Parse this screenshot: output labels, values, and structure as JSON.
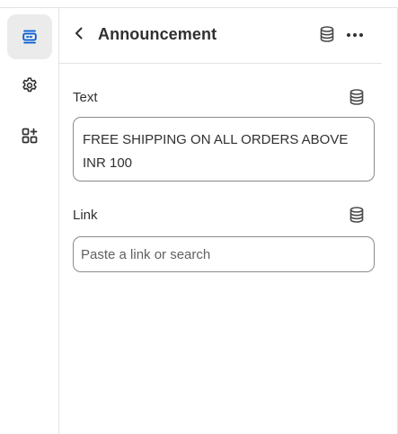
{
  "rail": {
    "items": [
      {
        "name": "sections",
        "icon": "sections-icon",
        "active": true
      },
      {
        "name": "settings",
        "icon": "gear-icon",
        "active": false
      },
      {
        "name": "apps",
        "icon": "apps-add-icon",
        "active": false
      }
    ]
  },
  "header": {
    "back_icon": "chevron-left-icon",
    "title": "Announcement",
    "dynamic_source_icon": "database-icon",
    "more_icon": "more-horizontal-icon"
  },
  "fields": {
    "text": {
      "label": "Text",
      "value": "FREE SHIPPING ON ALL ORDERS ABOVE INR 100",
      "source_icon": "database-icon"
    },
    "link": {
      "label": "Link",
      "value": "",
      "placeholder": "Paste a link or search",
      "source_icon": "database-icon"
    }
  },
  "colors": {
    "accent": "#005bd3",
    "active_bg": "#ebebeb",
    "border": "#8a8a8a",
    "divider": "#e3e3e3",
    "text": "#303030"
  }
}
